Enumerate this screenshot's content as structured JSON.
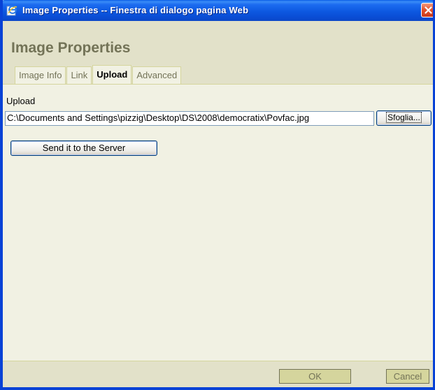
{
  "window": {
    "title": "Image Properties -- Finestra di dialogo pagina Web",
    "icon": "ie-page-icon",
    "close_icon": "close-icon"
  },
  "dialog": {
    "heading": "Image Properties"
  },
  "tabs": [
    {
      "label": "Image Info",
      "active": false
    },
    {
      "label": "Link",
      "active": false
    },
    {
      "label": "Upload",
      "active": true
    },
    {
      "label": "Advanced",
      "active": false
    }
  ],
  "upload": {
    "label": "Upload",
    "file_value": "C:\\Documents and Settings\\pizzig\\Desktop\\DS\\2008\\democratix\\Povfac.jpg",
    "browse_label": "Sfoglia...",
    "send_label": "Send it to the Server"
  },
  "footer": {
    "ok_label": "OK",
    "cancel_label": "Cancel"
  },
  "colors": {
    "title_bar": "#0a4ed6",
    "header_bg": "#e2e1c9",
    "content_bg": "#f1f1e3",
    "heading_text": "#737357",
    "close_button": "#e2532c"
  }
}
